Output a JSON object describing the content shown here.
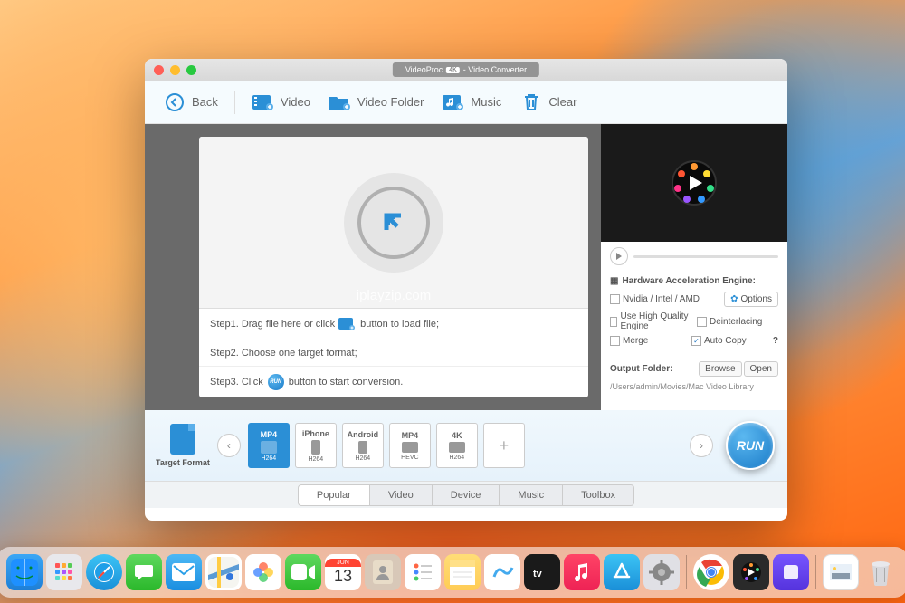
{
  "window": {
    "title_prefix": "VideoProc",
    "title_badge": "4K",
    "title_suffix": "- Video Converter"
  },
  "toolbar": {
    "back": "Back",
    "video": "Video",
    "video_folder": "Video Folder",
    "music": "Music",
    "clear": "Clear"
  },
  "watermark": "iplayzip.com",
  "steps": {
    "s1a": "Step1. Drag file here or click",
    "s1b": "button to load file;",
    "s2": "Step2. Choose one target format;",
    "s3a": "Step3. Click",
    "s3b": "button to start conversion."
  },
  "side": {
    "hw_title": "Hardware Acceleration Engine:",
    "gpu": "Nvidia / Intel / AMD",
    "options": "Options",
    "hq": "Use High Quality Engine",
    "deint": "Deinterlacing",
    "merge": "Merge",
    "autocopy": "Auto Copy",
    "out_label": "Output Folder:",
    "browse": "Browse",
    "open": "Open",
    "out_path": "/Users/admin/Movies/Mac Video Library"
  },
  "formats": {
    "target_label": "Target Format",
    "items": [
      {
        "t": "MP4",
        "s": "H264"
      },
      {
        "t": "iPhone",
        "s": "H264"
      },
      {
        "t": "Android",
        "s": "H264"
      },
      {
        "t": "MP4",
        "s": "HEVC"
      },
      {
        "t": "4K",
        "s": "H264"
      }
    ]
  },
  "run": "RUN",
  "tabs": [
    "Popular",
    "Video",
    "Device",
    "Music",
    "Toolbox"
  ],
  "dock": {
    "calendar_day": "13",
    "calendar_month": "JUN"
  }
}
